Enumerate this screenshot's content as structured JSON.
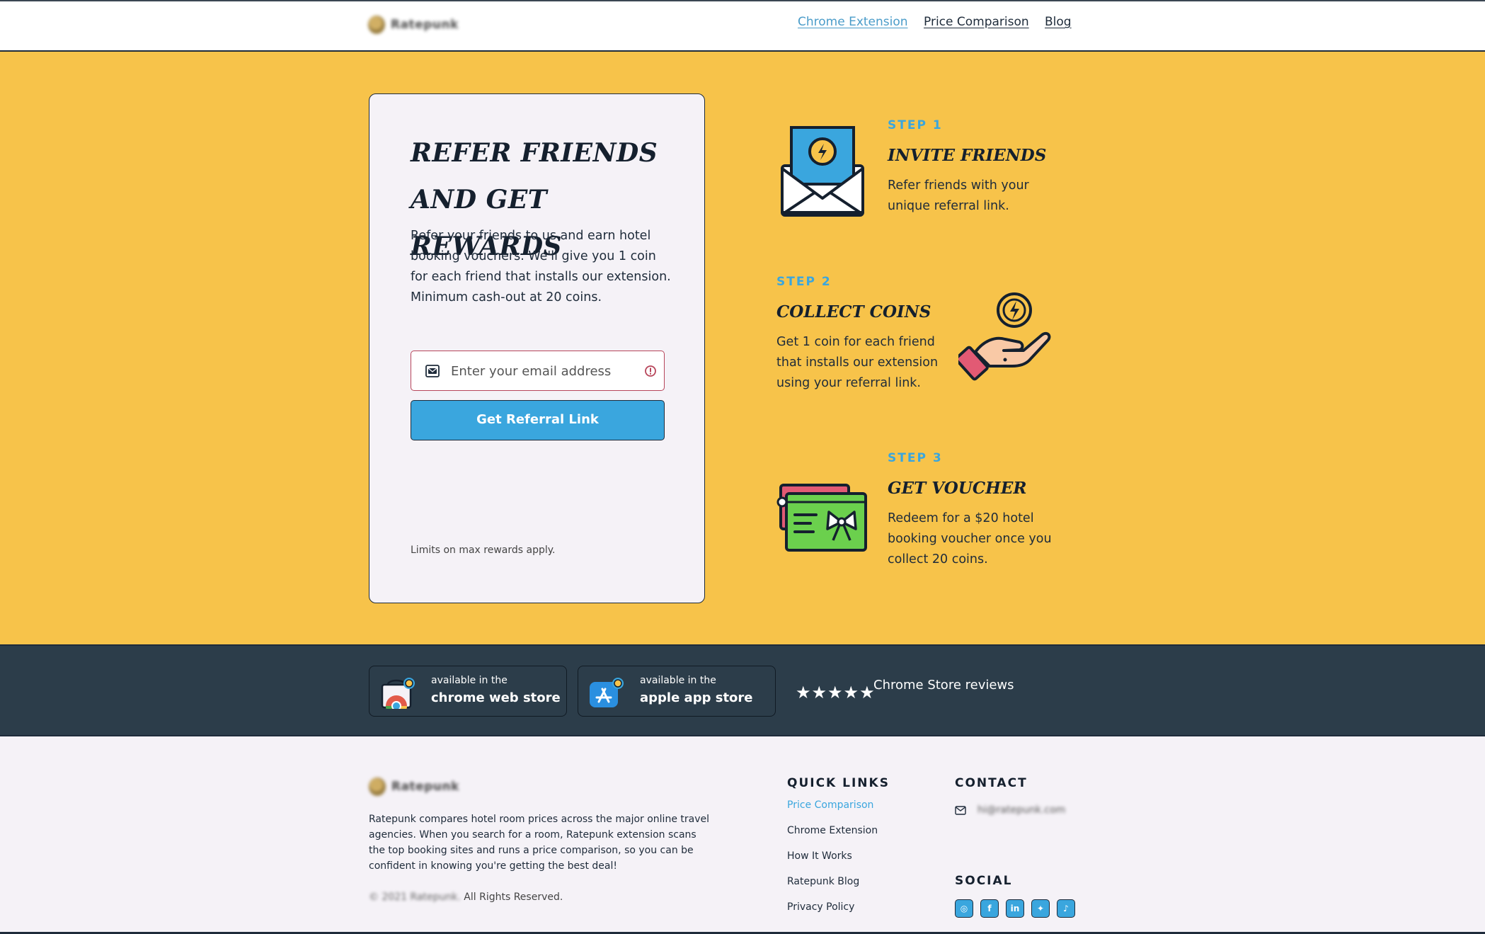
{
  "header": {
    "logo_text": "Ratepunk",
    "nav": [
      {
        "label": "Chrome Extension",
        "active": true
      },
      {
        "label": "Price Comparison",
        "active": false
      },
      {
        "label": "Blog",
        "active": false
      }
    ]
  },
  "referral": {
    "title": "Refer friends and get rewards",
    "description": "Refer your friends to us and earn hotel booking vouchers. We'll give you 1 coin for each friend that installs our extension. Minimum cash-out at 20 coins.",
    "email_placeholder": "Enter your email address",
    "button_label": "Get Referral Link",
    "fine_print": "Limits on max rewards apply."
  },
  "steps": [
    {
      "label": "STEP 1",
      "title": "Invite Friends",
      "text": "Refer friends with your unique referral link.",
      "icon": "envelope-coin-icon"
    },
    {
      "label": "STEP 2",
      "title": "Collect Coins",
      "text": "Get 1 coin for each friend that installs our extension using your referral link.",
      "icon": "hand-coin-icon"
    },
    {
      "label": "STEP 3",
      "title": "Get Voucher",
      "text": "Redeem for a $20 hotel booking voucher once you collect 20 coins.",
      "icon": "gift-voucher-icon"
    }
  ],
  "stores": [
    {
      "small": "available in the",
      "big": "chrome web store",
      "icon": "chrome-store-icon"
    },
    {
      "small": "available in the",
      "big": "apple app store",
      "icon": "app-store-icon"
    }
  ],
  "reviews": {
    "stars": "★★★★★",
    "label": "Chrome Store reviews"
  },
  "footer": {
    "about": "Ratepunk compares hotel room prices across the major online travel agencies. When you search for a room, Ratepunk extension scans the top booking sites and runs a price comparison, so you can be confident in knowing you're getting the best deal!",
    "copyright_blurred": "© 2021 Ratepunk.",
    "copyright_tail": "All Rights Reserved.",
    "quick_links_heading": "QUICK LINKS",
    "quick_links": [
      {
        "label": "Price Comparison",
        "active": true
      },
      {
        "label": "Chrome Extension",
        "active": false
      },
      {
        "label": "How It Works",
        "active": false
      },
      {
        "label": "Ratepunk Blog",
        "active": false
      },
      {
        "label": "Privacy Policy",
        "active": false
      }
    ],
    "contact_heading": "CONTACT",
    "contact_email": "hi@ratepunk.com",
    "social_heading": "SOCIAL",
    "socials": [
      {
        "name": "instagram-icon",
        "glyph": "◎"
      },
      {
        "name": "facebook-icon",
        "glyph": "f"
      },
      {
        "name": "linkedin-icon",
        "glyph": "in"
      },
      {
        "name": "twitter-icon",
        "glyph": "✦"
      },
      {
        "name": "tiktok-icon",
        "glyph": "♪"
      }
    ]
  },
  "colors": {
    "hero_bg": "#f7c34a",
    "accent": "#3aa6de",
    "dark": "#2c3d4a",
    "error": "#b7455a"
  }
}
